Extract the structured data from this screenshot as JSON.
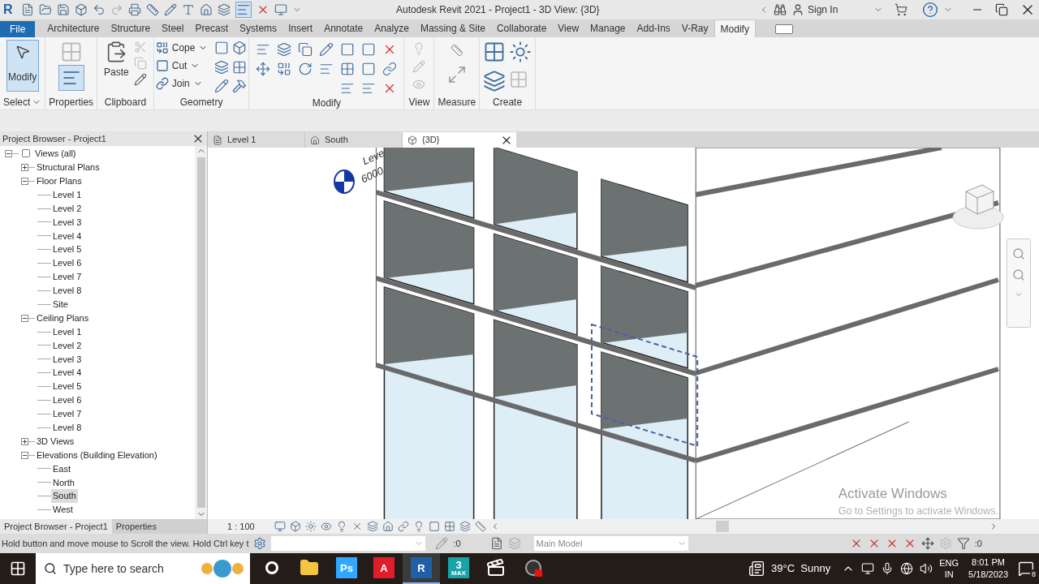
{
  "window": {
    "app_logo": "R",
    "title": "Autodesk Revit 2021 - Project1 - 3D View: {3D}",
    "sign_in": "Sign In"
  },
  "ribbon_tabs": [
    {
      "label": "File",
      "kind": "file",
      "selected": false
    },
    {
      "label": "Architecture",
      "kind": "tab",
      "selected": false
    },
    {
      "label": "Structure",
      "kind": "tab",
      "selected": false
    },
    {
      "label": "Steel",
      "kind": "tab",
      "selected": false
    },
    {
      "label": "Precast",
      "kind": "tab",
      "selected": false
    },
    {
      "label": "Systems",
      "kind": "tab",
      "selected": false
    },
    {
      "label": "Insert",
      "kind": "tab",
      "selected": false
    },
    {
      "label": "Annotate",
      "kind": "tab",
      "selected": false
    },
    {
      "label": "Analyze",
      "kind": "tab",
      "selected": false
    },
    {
      "label": "Massing & Site",
      "kind": "tab",
      "selected": false
    },
    {
      "label": "Collaborate",
      "kind": "tab",
      "selected": false
    },
    {
      "label": "View",
      "kind": "tab",
      "selected": false
    },
    {
      "label": "Manage",
      "kind": "tab",
      "selected": false
    },
    {
      "label": "Add-Ins",
      "kind": "tab",
      "selected": false
    },
    {
      "label": "V-Ray",
      "kind": "tab",
      "selected": false
    },
    {
      "label": "Modify",
      "kind": "tab",
      "selected": true
    }
  ],
  "ribbon_panels": [
    {
      "label": "Select",
      "kind": "select",
      "tools": [
        "Modify"
      ]
    },
    {
      "label": "Properties",
      "kind": "properties"
    },
    {
      "label": "Clipboard",
      "kind": "clipboard",
      "tools": [
        "Paste"
      ]
    },
    {
      "label": "Geometry",
      "kind": "geometry",
      "tools": [
        "Cope",
        "Cut",
        "Join"
      ]
    },
    {
      "label": "Modify",
      "kind": "modify"
    },
    {
      "label": "View",
      "kind": "view"
    },
    {
      "label": "Measure",
      "kind": "measure"
    },
    {
      "label": "Create",
      "kind": "create"
    }
  ],
  "browser": {
    "title": "Project Browser - Project1",
    "tree": [
      {
        "label": "Views (all)",
        "expanded": true,
        "selected": false,
        "children": [
          {
            "label": "Structural Plans",
            "expanded": false,
            "selected": false
          },
          {
            "label": "Floor Plans",
            "expanded": true,
            "selected": false,
            "children": [
              {
                "label": "Level 1",
                "selected": false
              },
              {
                "label": "Level 2",
                "selected": false
              },
              {
                "label": "Level 3",
                "selected": false
              },
              {
                "label": "Level 4",
                "selected": false
              },
              {
                "label": "Level 5",
                "selected": false
              },
              {
                "label": "Level 6",
                "selected": false
              },
              {
                "label": "Level 7",
                "selected": false
              },
              {
                "label": "Level 8",
                "selected": false
              },
              {
                "label": "Site",
                "selected": false
              }
            ]
          },
          {
            "label": "Ceiling Plans",
            "expanded": true,
            "selected": false,
            "children": [
              {
                "label": "Level 1",
                "selected": false
              },
              {
                "label": "Level 2",
                "selected": false
              },
              {
                "label": "Level 3",
                "selected": false
              },
              {
                "label": "Level 4",
                "selected": false
              },
              {
                "label": "Level 5",
                "selected": false
              },
              {
                "label": "Level 6",
                "selected": false
              },
              {
                "label": "Level 7",
                "selected": false
              },
              {
                "label": "Level 8",
                "selected": false
              }
            ]
          },
          {
            "label": "3D Views",
            "expanded": false,
            "selected": false
          },
          {
            "label": "Elevations (Building Elevation)",
            "expanded": true,
            "selected": false,
            "children": [
              {
                "label": "East",
                "selected": false
              },
              {
                "label": "North",
                "selected": false
              },
              {
                "label": "South",
                "selected": true
              },
              {
                "label": "West",
                "selected": false
              }
            ]
          }
        ]
      }
    ],
    "bottom_tabs": [
      {
        "label": "Project Browser - Project1",
        "selected": true
      },
      {
        "label": "Properties",
        "selected": false
      }
    ]
  },
  "view_tabs": [
    {
      "label": "Level 1",
      "kind": "plan",
      "selected": false
    },
    {
      "label": "South",
      "kind": "elevation",
      "selected": false
    },
    {
      "label": "{3D}",
      "kind": "model",
      "selected": true
    }
  ],
  "viewport": {
    "level_name": "Leve",
    "level_elevation": "6000",
    "activation_title": "Activate Windows",
    "activation_hint": "Go to Settings to activate Windows."
  },
  "view_control": {
    "scale": "1 : 100"
  },
  "status_bar": {
    "message": "Hold button and move mouse to Scroll the view. Hold Ctrl key t",
    "workset_count": ":0",
    "model": "Main Model",
    "filter_count": ":0"
  },
  "taskbar": {
    "search_placeholder": "Type here to search",
    "apps": [
      {
        "kind": "cortana",
        "selected": false
      },
      {
        "kind": "folder",
        "selected": false
      },
      {
        "kind": "logo",
        "label": "Ps",
        "color": "#31a8ff",
        "selected": false
      },
      {
        "kind": "logo",
        "label": "A",
        "color": "#e11d2a",
        "selected": false
      },
      {
        "kind": "logo",
        "label": "R",
        "color": "#1f5fa8",
        "selected": true
      },
      {
        "kind": "logo",
        "label": "3",
        "sublabel": "MAX",
        "color": "#18a3a8",
        "selected": false
      },
      {
        "kind": "clapper",
        "selected": false
      },
      {
        "kind": "recorder",
        "selected": false
      }
    ],
    "weather": "39°C  Sunny",
    "lang": "ENG",
    "region": "IN",
    "time": "8:01 PM",
    "date": "5/18/2023",
    "notifications": "8"
  }
}
